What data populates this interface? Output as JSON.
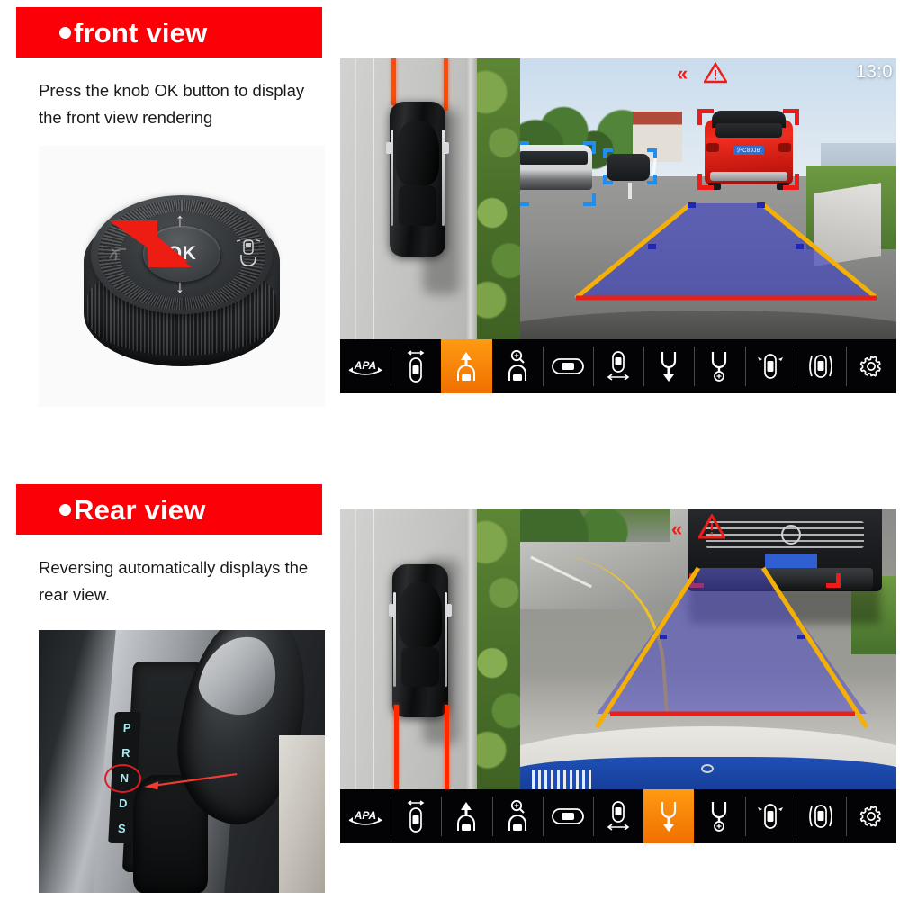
{
  "sections": [
    {
      "id": "front",
      "header": {
        "title": "front view",
        "bullet": "●",
        "bg": "#fb0007"
      },
      "caption": "Press the knob OK button to display the front view rendering",
      "photo": {
        "name": "rotary-knob-photo",
        "ok_label": "OK",
        "up_arrow": "↑",
        "down_arrow": "↓",
        "annotation": "red-arrow-pointing-to-ok"
      },
      "display": {
        "hud": {
          "chevron": "«",
          "warning": "warning-triangle",
          "time": "13:0"
        },
        "birdseye": {
          "guide_color": "#ff4b08",
          "guide_position": "front"
        },
        "camera": {
          "scene": "front-camera-red-suv-ahead",
          "plate_text": "沪C89JB",
          "trapezoid_fill": "#3b3fc4",
          "near_edge_color": "#e8201c",
          "side_edge_color": "#f5b006",
          "brackets": [
            {
              "target": "red-suv",
              "color": "#ef1b18"
            },
            {
              "target": "white-van",
              "color": "#1d8ff2"
            },
            {
              "target": "dark-car",
              "color": "#1d8ff2"
            }
          ]
        },
        "toolbar": {
          "active_index": 2,
          "items": [
            {
              "name": "apa-auto-parking",
              "label": "APA"
            },
            {
              "name": "panorama-3d-view",
              "label": ""
            },
            {
              "name": "front-view",
              "label": ""
            },
            {
              "name": "front-zoom-view",
              "label": ""
            },
            {
              "name": "wide-view",
              "label": ""
            },
            {
              "name": "side-view",
              "label": ""
            },
            {
              "name": "rear-view",
              "label": ""
            },
            {
              "name": "rear-zoom-view",
              "label": ""
            },
            {
              "name": "left-right-view",
              "label": ""
            },
            {
              "name": "transparent-chassis-view",
              "label": ""
            },
            {
              "name": "settings",
              "label": ""
            }
          ]
        }
      }
    },
    {
      "id": "rear",
      "header": {
        "title": "Rear view",
        "bullet": "●",
        "bg": "#fb0007"
      },
      "caption": "Reversing automatically displays the rear view.",
      "photo": {
        "name": "gear-shifter-photo",
        "gears": [
          "P",
          "R",
          "N",
          "D",
          "S"
        ],
        "highlighted_gear": "R",
        "annotation": "red-circle-and-arrow-on-R"
      },
      "display": {
        "hud": {
          "chevron": "«",
          "warning": "warning-triangle",
          "time": ""
        },
        "birdseye": {
          "guide_color": "#ff2a00",
          "guide_position": "rear"
        },
        "camera": {
          "scene": "rear-camera-dark-suv-behind",
          "plate_text": "",
          "trapezoid_fill": "#4b49c9",
          "near_edge_color": "#e8201c",
          "side_edge_color": "#f5b006",
          "brackets": [
            {
              "target": "dark-suv-left",
              "color": "#ef1b18"
            },
            {
              "target": "dark-suv-right",
              "color": "#ef1b18"
            }
          ]
        },
        "toolbar": {
          "active_index": 6,
          "items": [
            {
              "name": "apa-auto-parking",
              "label": "APA"
            },
            {
              "name": "panorama-3d-view",
              "label": ""
            },
            {
              "name": "front-view",
              "label": ""
            },
            {
              "name": "front-zoom-view",
              "label": ""
            },
            {
              "name": "wide-view",
              "label": ""
            },
            {
              "name": "side-view",
              "label": ""
            },
            {
              "name": "rear-view",
              "label": ""
            },
            {
              "name": "rear-zoom-view",
              "label": ""
            },
            {
              "name": "left-right-view",
              "label": ""
            },
            {
              "name": "transparent-chassis-view",
              "label": ""
            },
            {
              "name": "settings",
              "label": ""
            }
          ]
        }
      }
    }
  ]
}
